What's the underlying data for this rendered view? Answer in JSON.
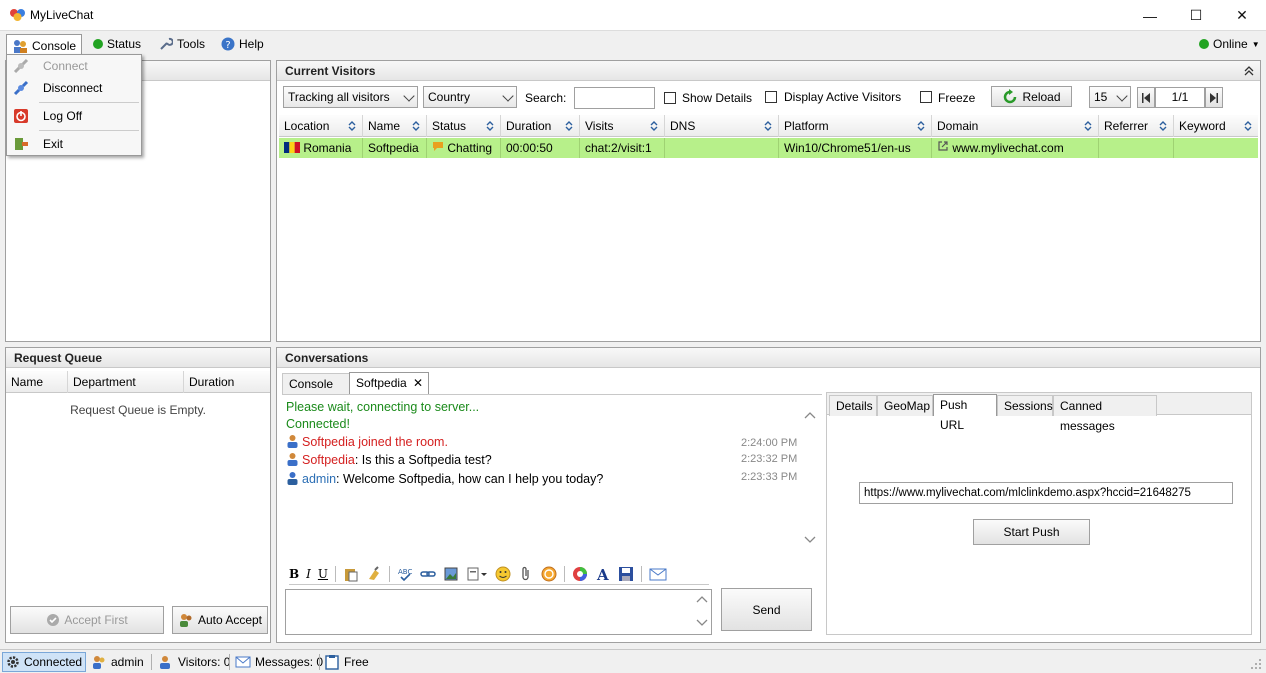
{
  "window": {
    "title": "MyLiveChat",
    "min_glyph": "—",
    "max_glyph": "☐",
    "close_glyph": "✕"
  },
  "menu": {
    "console": "Console",
    "status": "Status",
    "tools": "Tools",
    "help": "Help",
    "online": "Online"
  },
  "console_menu": {
    "connect": "Connect",
    "disconnect": "Disconnect",
    "logoff": "Log Off",
    "exit": "Exit"
  },
  "visitors": {
    "title": "Current Visitors",
    "tracking_select": "Tracking all visitors",
    "country_select": "Country",
    "search_label": "Search:",
    "search_value": "",
    "show_details": "Show Details",
    "display_active": "Display Active Visitors",
    "freeze": "Freeze",
    "reload": "Reload",
    "page_size": "15",
    "page_indicator": "1/1",
    "columns": [
      "Location",
      "Name",
      "Status",
      "Duration",
      "Visits",
      "DNS",
      "Platform",
      "Domain",
      "Referrer",
      "Keyword"
    ],
    "rows": [
      {
        "location": "Romania",
        "name": "Softpedia",
        "status": "Chatting",
        "duration": "00:00:50",
        "visits": "chat:2/visit:1",
        "dns": "",
        "platform": "Win10/Chrome51/en-us",
        "domain": "www.mylivechat.com",
        "referrer": "",
        "keyword": ""
      }
    ]
  },
  "queue": {
    "title": "Request Queue",
    "columns": [
      "Name",
      "Department",
      "Duration"
    ],
    "empty_text": "Request Queue is Empty.",
    "accept_first": "Accept First",
    "auto_accept": "Auto Accept"
  },
  "conversations": {
    "title": "Conversations",
    "tabs": [
      "Console",
      "Softpedia"
    ],
    "messages": [
      {
        "text": "Please wait, connecting to server...",
        "color": "#1a8a1a"
      },
      {
        "text": "Connected!",
        "color": "#1a8a1a"
      }
    ],
    "chat": [
      {
        "user": "Softpedia joined the room.",
        "text": "",
        "time": "2:24:00 PM",
        "user_color": "#d42020"
      },
      {
        "user": "Softpedia",
        "text": ": Is this a Softpedia test?",
        "time": "2:23:32 PM",
        "user_color": "#d42020"
      },
      {
        "user": "admin",
        "text": ": Welcome Softpedia, how can I help you today?",
        "time": "2:23:33 PM",
        "user_color": "#2c6fb5"
      }
    ],
    "compose_value": "",
    "send": "Send",
    "format": {
      "bold": "B",
      "italic": "I",
      "underline": "U"
    }
  },
  "details": {
    "tabs": [
      "Details",
      "GeoMap",
      "Push URL",
      "Sessions",
      "Canned messages"
    ],
    "push_url_value": "https://www.mylivechat.com/mlclinkdemo.aspx?hccid=21648275",
    "start_push": "Start Push"
  },
  "statusbar": {
    "connected": "Connected",
    "user": "admin",
    "visitors": "Visitors: 0",
    "messages": "Messages: 0",
    "free": "Free"
  },
  "colors": {
    "row_highlight": "#b7f08a",
    "status_online": "#22a322",
    "system_text": "#1a8a1a",
    "visitor_name": "#d42020",
    "operator_name": "#2c6fb5"
  }
}
